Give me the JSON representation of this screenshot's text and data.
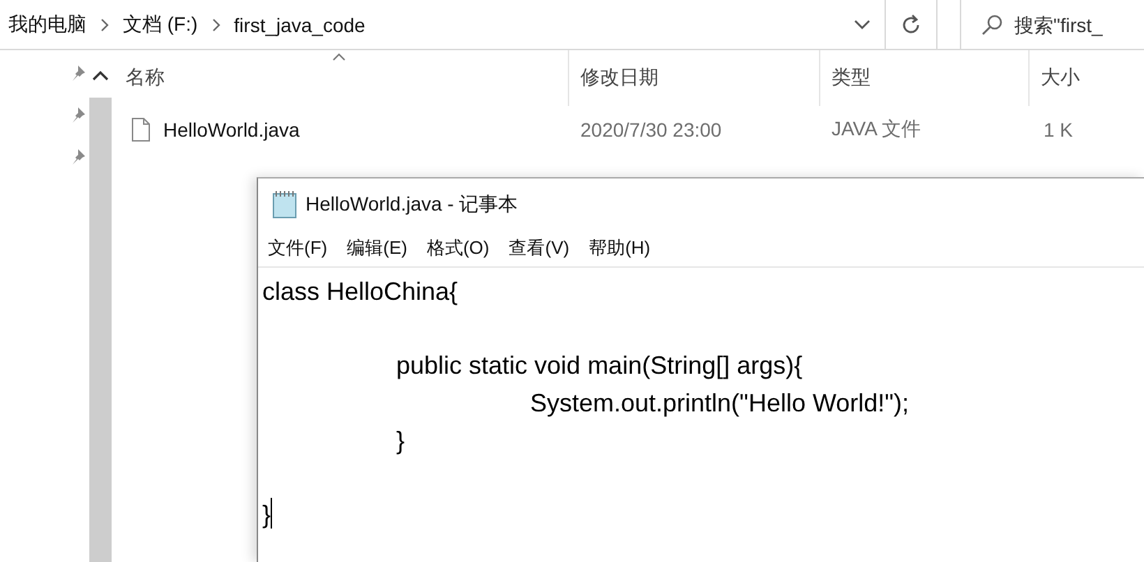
{
  "explorer": {
    "breadcrumb": [
      "我的电脑",
      "文档 (F:)",
      "first_java_code"
    ],
    "search": {
      "placeholder": "搜索\"first_"
    },
    "columns": [
      "名称",
      "修改日期",
      "类型",
      "大小"
    ],
    "files": [
      {
        "name": "HelloWorld.java",
        "modified": "2020/7/30 23:00",
        "type": "JAVA 文件",
        "size": "1 K"
      }
    ]
  },
  "notepad": {
    "title": "HelloWorld.java - 记事本",
    "menu": [
      "文件(F)",
      "编辑(E)",
      "格式(O)",
      "查看(V)",
      "帮助(H)"
    ],
    "text": "class HelloChina{\n\n\tpublic static void main(String[] args){\n\t\tSystem.out.println(\"Hello World!\");\n\t}\n\n}"
  }
}
